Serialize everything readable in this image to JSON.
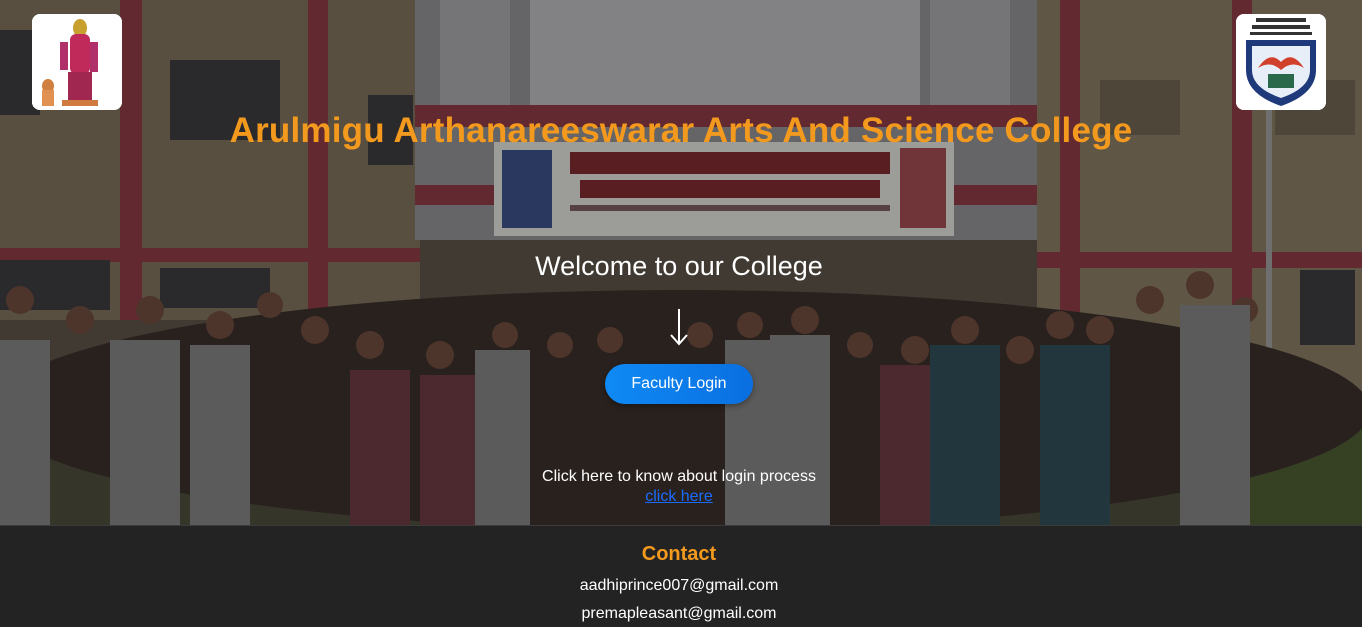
{
  "header": {
    "college_name": "Arulmigu Arthanareeswarar Arts And Science College",
    "left_logo_icon": "deity-emblem-icon",
    "right_logo_icon": "college-crest-icon"
  },
  "hero": {
    "welcome_text": "Welcome to our College",
    "arrow_icon": "arrow-down-icon",
    "login_button_label": "Faculty Login",
    "login_info_text": "Click here to know about login process",
    "login_info_link": "click here",
    "background_icon": "college-group-photo"
  },
  "footer": {
    "contact_heading": "Contact",
    "emails": [
      "aadhiprince007@gmail.com",
      "premapleasant@gmail.com"
    ]
  },
  "colors": {
    "accent": "#f39a1e",
    "button": "#0a7ef0",
    "link": "#1a6cff",
    "footer_bg": "#232323"
  }
}
